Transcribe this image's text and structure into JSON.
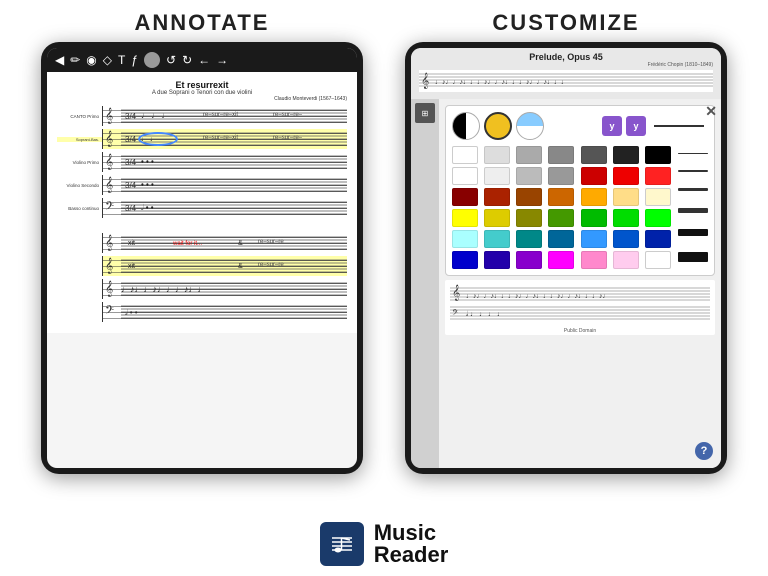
{
  "left_label": "ANNOTATE",
  "right_label": "CUSTOMIZE",
  "left_tablet": {
    "sheet_title": "Et resurrexit",
    "sheet_subtitle": "A due Soprani o Tenori con due violini",
    "sheet_composer": "Claudio Monteverdi (1567–1643)",
    "staff_rows": [
      {
        "label": "CANTO Primo",
        "highlight": false
      },
      {
        "label": "Soprani-Bas.",
        "highlight": true
      },
      {
        "label": "",
        "highlight": false
      },
      {
        "label": "Violino Primo",
        "highlight": false
      },
      {
        "label": "Violino Secondo",
        "highlight": false
      },
      {
        "label": "Basso continuo",
        "highlight": false
      }
    ],
    "red_text": "wait for it...",
    "bottom_rows": [
      {
        "highlight": false
      },
      {
        "highlight": true
      },
      {
        "highlight": false
      },
      {
        "highlight": false
      }
    ]
  },
  "right_tablet": {
    "title": "Prelude, Opus 45",
    "composer": "Frédéric Chopin (1810–1849)",
    "publisher": "Public Domain",
    "help_label": "?",
    "close_label": "✕",
    "style_buttons": [
      {
        "type": "half-black",
        "label": ""
      },
      {
        "type": "yellow",
        "label": ""
      },
      {
        "type": "half-blue",
        "label": ""
      }
    ],
    "y_buttons": [
      "y",
      "y"
    ],
    "color_rows": [
      [
        "#ffffff",
        "#dddddd",
        "#aaaaaa",
        "#888888",
        "#555555",
        "#222222",
        "#000000"
      ],
      [
        "#ffffff",
        "#eeeeee",
        "#bbbbbb",
        "#999999",
        "#cc0000",
        "#ee0000",
        "#ff2222"
      ],
      [
        "#880000",
        "#aa2200",
        "#994400",
        "#cc6600",
        "#ffaa00",
        "#ffdd88",
        "#fff8cc"
      ],
      [
        "#ffff00",
        "#ddcc00",
        "#888800",
        "#449900",
        "#00bb00",
        "#00dd00",
        "#00ff00"
      ],
      [
        "#aaffff",
        "#44cccc",
        "#008888",
        "#006699",
        "#3399ff",
        "#0055cc",
        "#0022aa"
      ],
      [
        "#0000cc",
        "#2200aa",
        "#8800cc",
        "#ff00ff",
        "#ff88cc",
        "#ffccee",
        "#ffffff"
      ]
    ],
    "line_thicknesses": [
      1,
      2,
      3,
      4,
      5,
      6
    ]
  },
  "branding": {
    "name_line1": "Music",
    "name_line2": "Reader"
  }
}
